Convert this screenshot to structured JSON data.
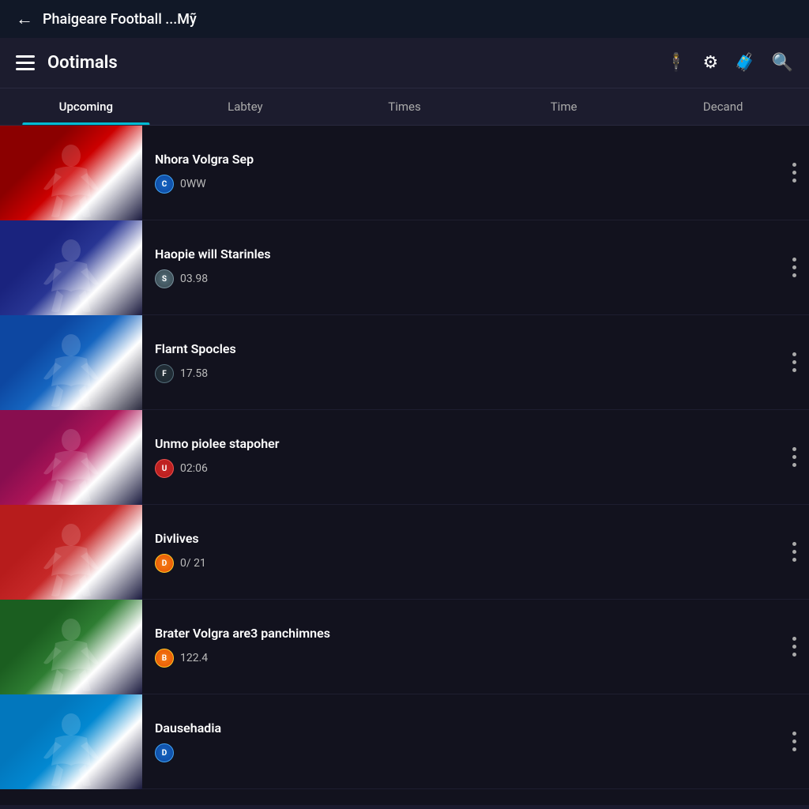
{
  "statusBar": {
    "backLabel": "←",
    "title": "Phaigeare Football ...Mỹ"
  },
  "toolbar": {
    "brandName": "Ootimals",
    "icons": {
      "person": "🕴",
      "settings": "⚙",
      "briefcase": "🧳",
      "search": "🔍"
    }
  },
  "tabs": [
    {
      "id": "upcoming",
      "label": "Upcoming",
      "active": true
    },
    {
      "id": "labtey",
      "label": "Labtey",
      "active": false
    },
    {
      "id": "times",
      "label": "Times",
      "active": false
    },
    {
      "id": "time",
      "label": "Time",
      "active": false
    },
    {
      "id": "decand",
      "label": "Decand",
      "active": false
    }
  ],
  "matches": [
    {
      "id": 1,
      "title": "Nhora Volgra Sep",
      "badgeClass": "badge-blue",
      "badgeText": "C",
      "time": "0WW",
      "thumbClass": "thumb-1"
    },
    {
      "id": 2,
      "title": "Haopie will Starinles",
      "badgeClass": "badge-gray",
      "badgeText": "S",
      "time": "03.98",
      "thumbClass": "thumb-2"
    },
    {
      "id": 3,
      "title": "Flarnt Spocles",
      "badgeClass": "badge-dark",
      "badgeText": "F",
      "time": "17.58",
      "thumbClass": "thumb-3"
    },
    {
      "id": 4,
      "title": "Unmo piolee stapoher",
      "badgeClass": "badge-red",
      "badgeText": "U",
      "time": "02:06",
      "thumbClass": "thumb-4"
    },
    {
      "id": 5,
      "title": "Divlives",
      "badgeClass": "badge-gold",
      "badgeText": "D",
      "time": "0/ 21",
      "thumbClass": "thumb-5"
    },
    {
      "id": 6,
      "title": "Brater Volgra are3 panchimnes",
      "badgeClass": "badge-gold",
      "badgeText": "B",
      "time": "122.4",
      "thumbClass": "thumb-6"
    },
    {
      "id": 7,
      "title": "Dausehadia",
      "badgeClass": "badge-blue",
      "badgeText": "D",
      "time": "",
      "thumbClass": "thumb-7"
    }
  ]
}
